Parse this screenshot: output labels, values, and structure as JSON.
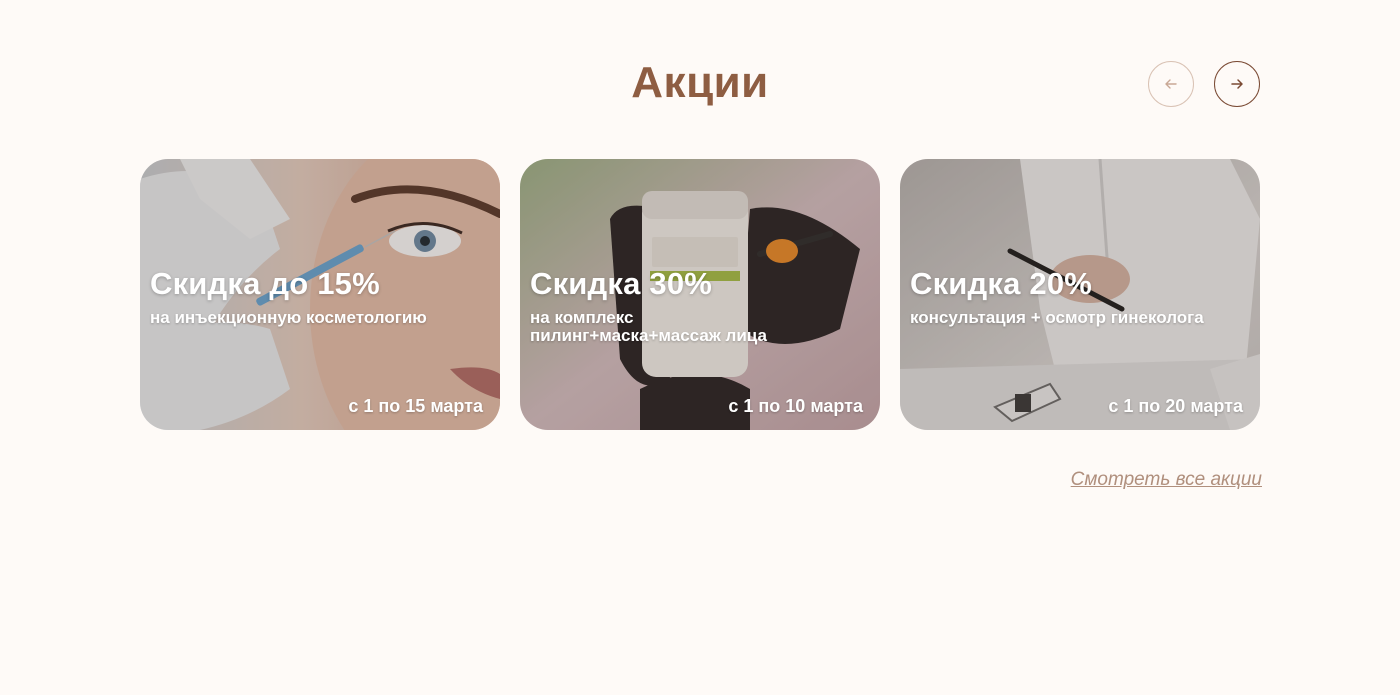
{
  "section": {
    "title": "Акции"
  },
  "nav": {
    "prev_icon": "arrow-left-icon",
    "next_icon": "arrow-right-icon"
  },
  "cards": [
    {
      "title": "Скидка до 15%",
      "subtitle": "на инъекционную косметологию",
      "dates": "с 1 по 15 марта"
    },
    {
      "title": "Скидка 30%",
      "subtitle": "на комплекс\nпилинг+маска+массаж лица",
      "dates": "с 1 по 10 марта"
    },
    {
      "title": "Скидка 20%",
      "subtitle": "консультация + осмотр гинеколога",
      "dates": "с 1 по 20 марта"
    }
  ],
  "footer": {
    "see_all_label": "Смотреть все акции"
  },
  "colors": {
    "background": "#fefaf7",
    "title": "#8e5d42",
    "link": "#b08f7d",
    "nav_border_active": "#7a4a34",
    "nav_border_inactive": "#d9c2b4"
  }
}
